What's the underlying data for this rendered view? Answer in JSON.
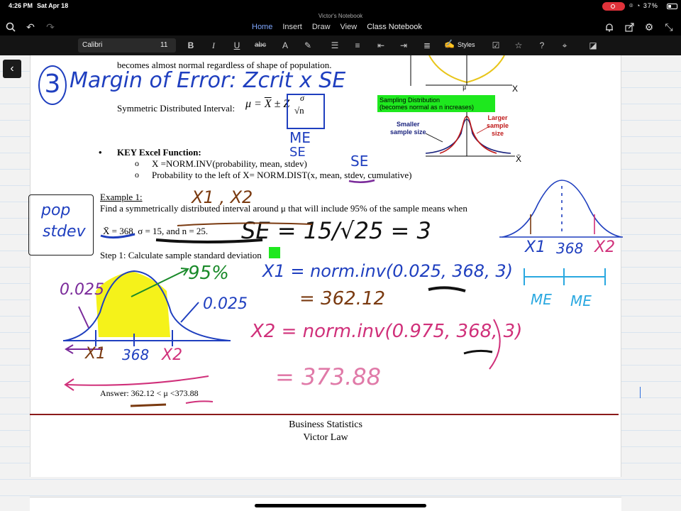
{
  "status": {
    "time": "4:26 PM",
    "date": "Sat Apr 18",
    "battery": "37%",
    "battery_level": 0.37
  },
  "window": {
    "title": "Victor's Notebook"
  },
  "tabs": [
    "Home",
    "Insert",
    "Draw",
    "View",
    "Class Notebook"
  ],
  "active_tab": "Home",
  "toolbar": {
    "font_name": "Calibri",
    "font_size": "11",
    "styles_label": "Styles"
  },
  "icons": {
    "search": "search-icon",
    "undo": "undo-icon",
    "redo": "redo-icon",
    "notifications": "bell-icon",
    "share": "share-icon",
    "settings": "gear-icon",
    "collapse": "collapse-icon",
    "back": "chevron-left-icon"
  },
  "doc": {
    "top_line": "becomes almost normal regardless of shape of population.",
    "sym_interval_label": "Symmetric Distributed Interval:",
    "key_excel": "KEY Excel Function:",
    "bullet1": "X =NORM.INV(probability, mean, stdev)",
    "bullet2": "Probability to the left of X= NORM.DIST(x, mean, stdev, cumulative)",
    "example_title": "Example 1:",
    "example_text": "Find a symmetrically distributed interval around μ that will include 95% of the sample means when",
    "given": "X̄ = 368, σ = 15, and n = 25.",
    "step1": "Step 1: Calculate sample standard deviation",
    "answer": "Answer: 362.12 < μ <373.88",
    "footer_course": "Business Statistics",
    "footer_author": "Victor Law",
    "sampling_box_line1": "Sampling Distribution",
    "sampling_box_line2": "(becomes normal as n increases)",
    "smaller": "Smaller",
    "sample_size": "sample size",
    "larger": "Larger",
    "sample": "sample",
    "size": "size",
    "mu": "μ",
    "x": "X",
    "xbar": "X̄"
  },
  "ink": {
    "heading": "Margin of Error: Zcrit x SE",
    "circle_num": "3",
    "me": "ME",
    "se": "SE",
    "se2": "SE",
    "pop_stdev_1": "pop",
    "pop_stdev_2": "stdev",
    "x1x2": "X1 , X2",
    "se_calc": "SE = 15/√25 = 3",
    "pct95": "95%",
    "p025_left": "0.025",
    "p025_right": "0.025",
    "x1_formula": "X1 = norm.inv(0.025, 368, 3)",
    "x1_result": "= 362.12",
    "x2_formula": "X2 = norm.inv(0.975, 368, 3)",
    "x2_result": "= 373.88",
    "axis_x1": "X1",
    "axis_368": "368",
    "axis_x2": "X2",
    "right_x1": "X1",
    "right_368": "368",
    "right_x2": "X2",
    "me_left": "ME",
    "me_right": "ME"
  },
  "colors": {
    "ink_blue": "#1f3fbf",
    "ink_brown": "#7a3a10",
    "ink_purple": "#7a2a9a",
    "ink_green": "#1a8a2a",
    "ink_pink": "#d0307a",
    "ink_cyan": "#2aa8e0",
    "ink_yellow": "#f5f21a",
    "page_rule": "#8b1a1a"
  }
}
